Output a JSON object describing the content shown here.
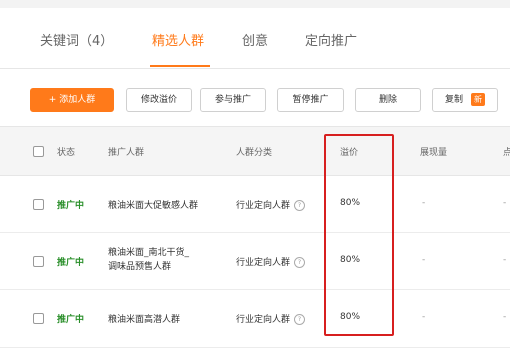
{
  "tabs": [
    {
      "label": "关键词（4）",
      "active": false
    },
    {
      "label": "精选人群",
      "active": true
    },
    {
      "label": "创意",
      "active": false
    },
    {
      "label": "定向推广",
      "active": false
    }
  ],
  "toolbar": {
    "add_label": "+ 添加人群",
    "modify_label": "修改溢价",
    "join_label": "参与推广",
    "pause_label": "暂停推广",
    "delete_label": "删除",
    "copy_label": "复制",
    "new_badge": "新"
  },
  "table": {
    "headers": [
      "状态",
      "推广人群",
      "人群分类",
      "溢价",
      "展现量",
      "点"
    ],
    "rows": [
      {
        "status": "推广中",
        "name_line1": "粮油米面大促敏感人群",
        "name_line2": "",
        "category": "行业定向人群",
        "premium": "80%",
        "impressions": "-",
        "extra": "-"
      },
      {
        "status": "推广中",
        "name_line1": "粮油米面_南北干货_",
        "name_line2": "调味品预售人群",
        "category": "行业定向人群",
        "premium": "80%",
        "impressions": "-",
        "extra": "-"
      },
      {
        "status": "推广中",
        "name_line1": "粮油米面高潜人群",
        "name_line2": "",
        "category": "行业定向人群",
        "premium": "80%",
        "impressions": "-",
        "extra": "-"
      }
    ]
  },
  "colors": {
    "accent": "#ff7a1a",
    "status": "#2a8f2a",
    "highlight": "#d71f1f"
  }
}
